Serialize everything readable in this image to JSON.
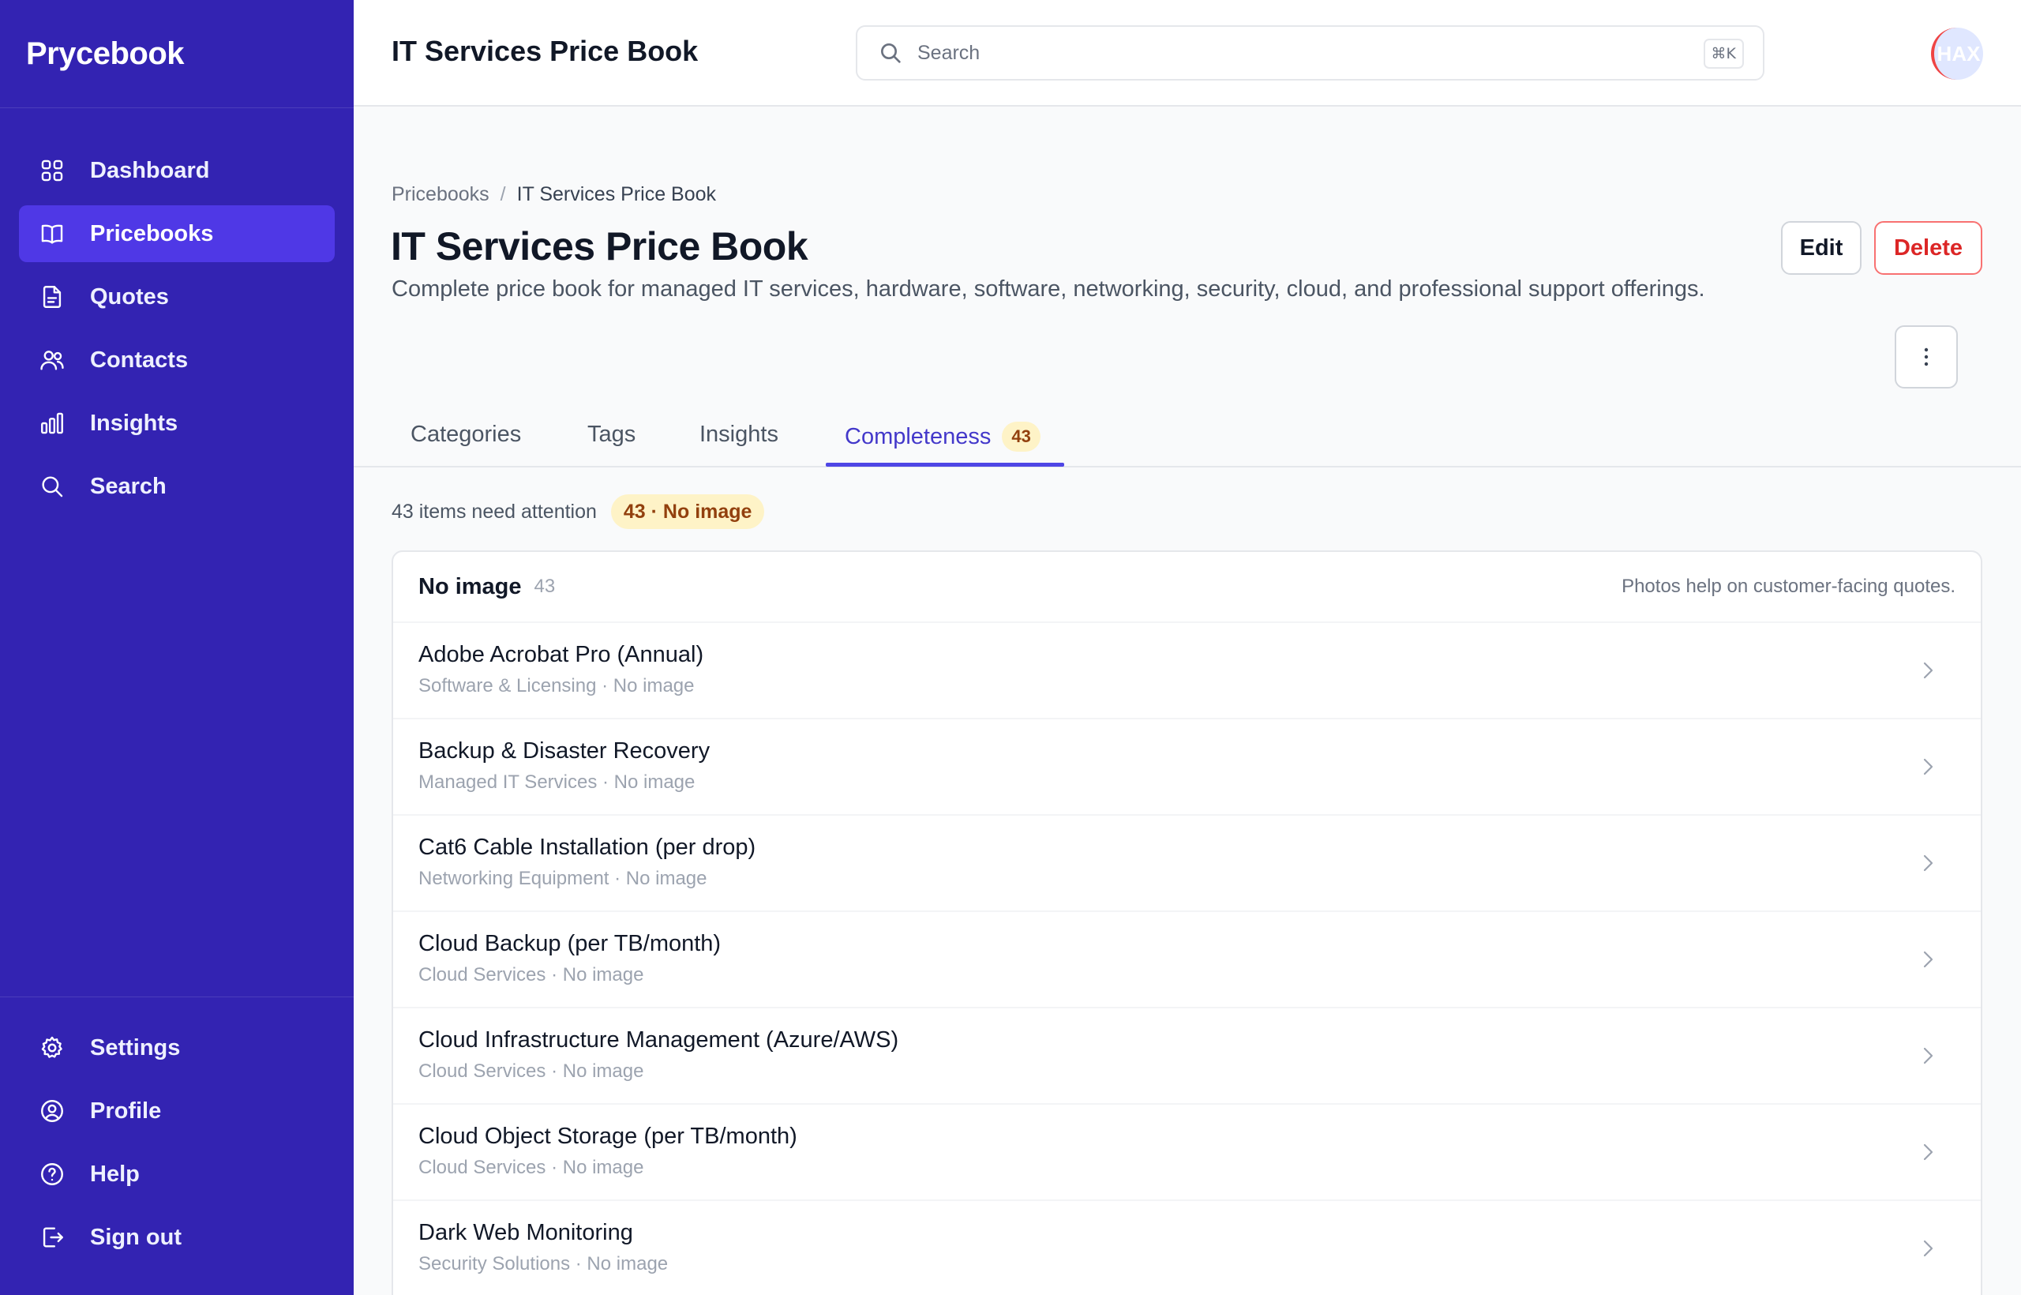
{
  "brand": "Prycebook",
  "sidebar": {
    "items": [
      {
        "label": "Dashboard",
        "icon": "grid-icon"
      },
      {
        "label": "Pricebooks",
        "icon": "book-icon",
        "active": true
      },
      {
        "label": "Quotes",
        "icon": "document-icon"
      },
      {
        "label": "Contacts",
        "icon": "users-icon"
      },
      {
        "label": "Insights",
        "icon": "bar-chart-icon"
      },
      {
        "label": "Search",
        "icon": "search-icon"
      }
    ],
    "bottom_items": [
      {
        "label": "Settings",
        "icon": "gear-icon"
      },
      {
        "label": "Profile",
        "icon": "user-circle-icon"
      },
      {
        "label": "Help",
        "icon": "help-circle-icon"
      },
      {
        "label": "Sign out",
        "icon": "sign-out-icon"
      }
    ]
  },
  "header": {
    "title": "IT Services Price Book",
    "search_placeholder": "Search",
    "search_shortcut": "⌘K",
    "avatar_initials": "HAX"
  },
  "breadcrumb": {
    "root": "Pricebooks",
    "separator": "/",
    "current": "IT Services Price Book"
  },
  "page": {
    "title": "IT Services Price Book",
    "description": "Complete price book for managed IT services, hardware, software, networking, security, cloud, and professional support offerings.",
    "edit_label": "Edit",
    "delete_label": "Delete"
  },
  "tabs": [
    {
      "label": "Categories"
    },
    {
      "label": "Tags"
    },
    {
      "label": "Insights"
    },
    {
      "label": "Completeness",
      "count": "43",
      "active": true
    }
  ],
  "attention": {
    "text": "43 items need attention",
    "badge": "43 · No image"
  },
  "list": {
    "title": "No image",
    "count": "43",
    "note": "Photos help on customer-facing quotes.",
    "items": [
      {
        "name": "Adobe Acrobat Pro (Annual)",
        "meta": "Software & Licensing · No image"
      },
      {
        "name": "Backup & Disaster Recovery",
        "meta": "Managed IT Services · No image"
      },
      {
        "name": "Cat6 Cable Installation (per drop)",
        "meta": "Networking Equipment · No image"
      },
      {
        "name": "Cloud Backup (per TB/month)",
        "meta": "Cloud Services · No image"
      },
      {
        "name": "Cloud Infrastructure Management (Azure/AWS)",
        "meta": "Cloud Services · No image"
      },
      {
        "name": "Cloud Object Storage (per TB/month)",
        "meta": "Cloud Services · No image"
      },
      {
        "name": "Dark Web Monitoring",
        "meta": "Security Solutions · No image"
      }
    ]
  },
  "colors": {
    "sidebar_bg": "#3323b2",
    "sidebar_active": "#4f38e6",
    "accent": "#4338ca",
    "danger": "#dc2626",
    "warning_bg": "#fef3c7",
    "warning_text": "#92400e"
  }
}
